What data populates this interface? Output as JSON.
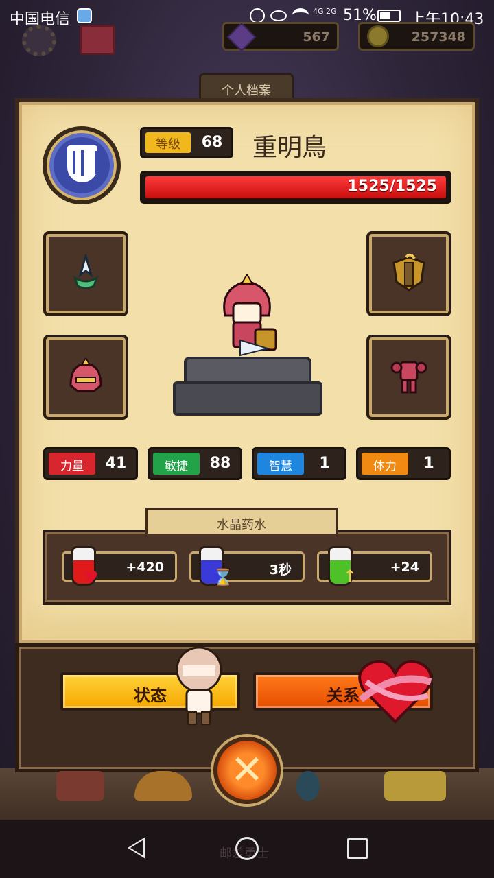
{
  "status_bar": {
    "carrier": "中国电信",
    "signal_label": "4G 2G",
    "battery": "51%",
    "time": "上午10:43"
  },
  "currency": {
    "gems": "567",
    "coins": "257348"
  },
  "panel": {
    "title": "个人档案",
    "level_label": "等级",
    "level_value": "68",
    "player_name": "重明鳥",
    "hp_text": "1525/1525",
    "hp_fraction": 1.0
  },
  "stats": [
    {
      "label": "力量",
      "value": "41",
      "color": "#d8262e"
    },
    {
      "label": "敏捷",
      "value": "88",
      "color": "#22a34a"
    },
    {
      "label": "智慧",
      "value": "1",
      "color": "#1f86e0"
    },
    {
      "label": "体力",
      "value": "1",
      "color": "#f08a12"
    }
  ],
  "potions": {
    "title": "水晶药水",
    "items": [
      {
        "value": "+420",
        "icon": "heart-plus-icon"
      },
      {
        "value": "3秒",
        "icon": "hourglass-icon"
      },
      {
        "value": "+24",
        "icon": "sword-up-icon"
      }
    ]
  },
  "actions": {
    "status_label": "状态",
    "relation_label": "关系",
    "close_symbol": "✕"
  },
  "navbar": {
    "ghost_text": "邮差勇士"
  },
  "colors": {
    "panel_bg": "#f2dfa9",
    "frame": "#3e2a1c",
    "hp_red": "#e01a1a",
    "level_gold": "#f1b81e"
  }
}
